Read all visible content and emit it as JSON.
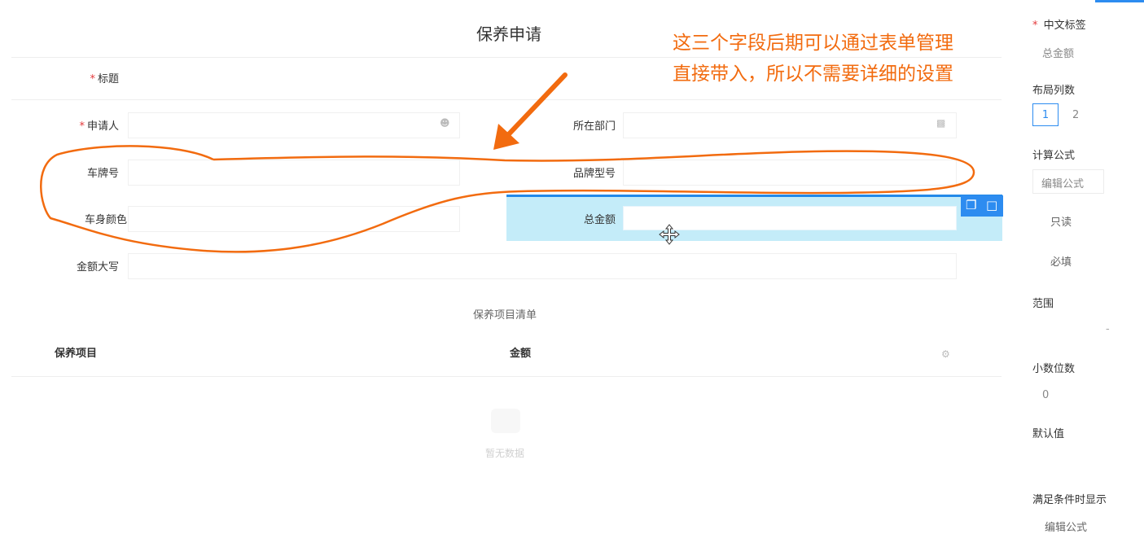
{
  "form": {
    "title": "保养申请",
    "fields": {
      "title_label": "标题",
      "applicant_label": "申请人",
      "department_label": "所在部门",
      "plate_label": "车牌号",
      "brand_label": "品牌型号",
      "color_label": "车身颜色",
      "total_label": "总金额",
      "total_upper_label": "金额大写"
    },
    "required_mark": "*",
    "sub_table": {
      "title": "保养项目清单",
      "columns": [
        "保养项目",
        "金额"
      ],
      "empty_text": "暂无数据"
    }
  },
  "annotation": {
    "line1": "这三个字段后期可以通过表单管理",
    "line2": "直接带入，所以不需要详细的设置",
    "color": "#f26b0f"
  },
  "panel": {
    "label_label": "中文标签",
    "label_value": "总金额",
    "columns_label": "布局列数",
    "column_options": [
      "1",
      "2"
    ],
    "formula_label": "计算公式",
    "formula_button": "编辑公式",
    "readonly": "只读",
    "required": "必填",
    "range_label": "范围",
    "range_sep": "-",
    "decimal_label": "小数位数",
    "decimal_value": "0",
    "default_label": "默认值",
    "condition_label": "满足条件时显示",
    "condition_button": "编辑公式"
  },
  "colors": {
    "accent": "#2d8cf0",
    "selected_bg": "#c4ecf9",
    "required": "#e4393c"
  },
  "icons": [
    "user-icon",
    "org-icon",
    "copy-icon",
    "delete-icon",
    "move-icon",
    "settings-icon"
  ]
}
